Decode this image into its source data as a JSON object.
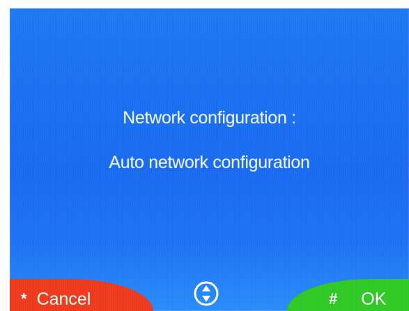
{
  "screen": {
    "title": "Network configuration :",
    "value": "Auto network configuration"
  },
  "softkeys": {
    "cancel_glyph": "*",
    "cancel_label": "Cancel",
    "ok_glyph": "#",
    "ok_label": "OK"
  },
  "icons": {
    "navigation": "up-down-navigation-icon"
  },
  "colors": {
    "background": "#1a6ff0",
    "cancel": "#ee3a1c",
    "ok": "#2fc825",
    "text": "#eaf3ff"
  }
}
